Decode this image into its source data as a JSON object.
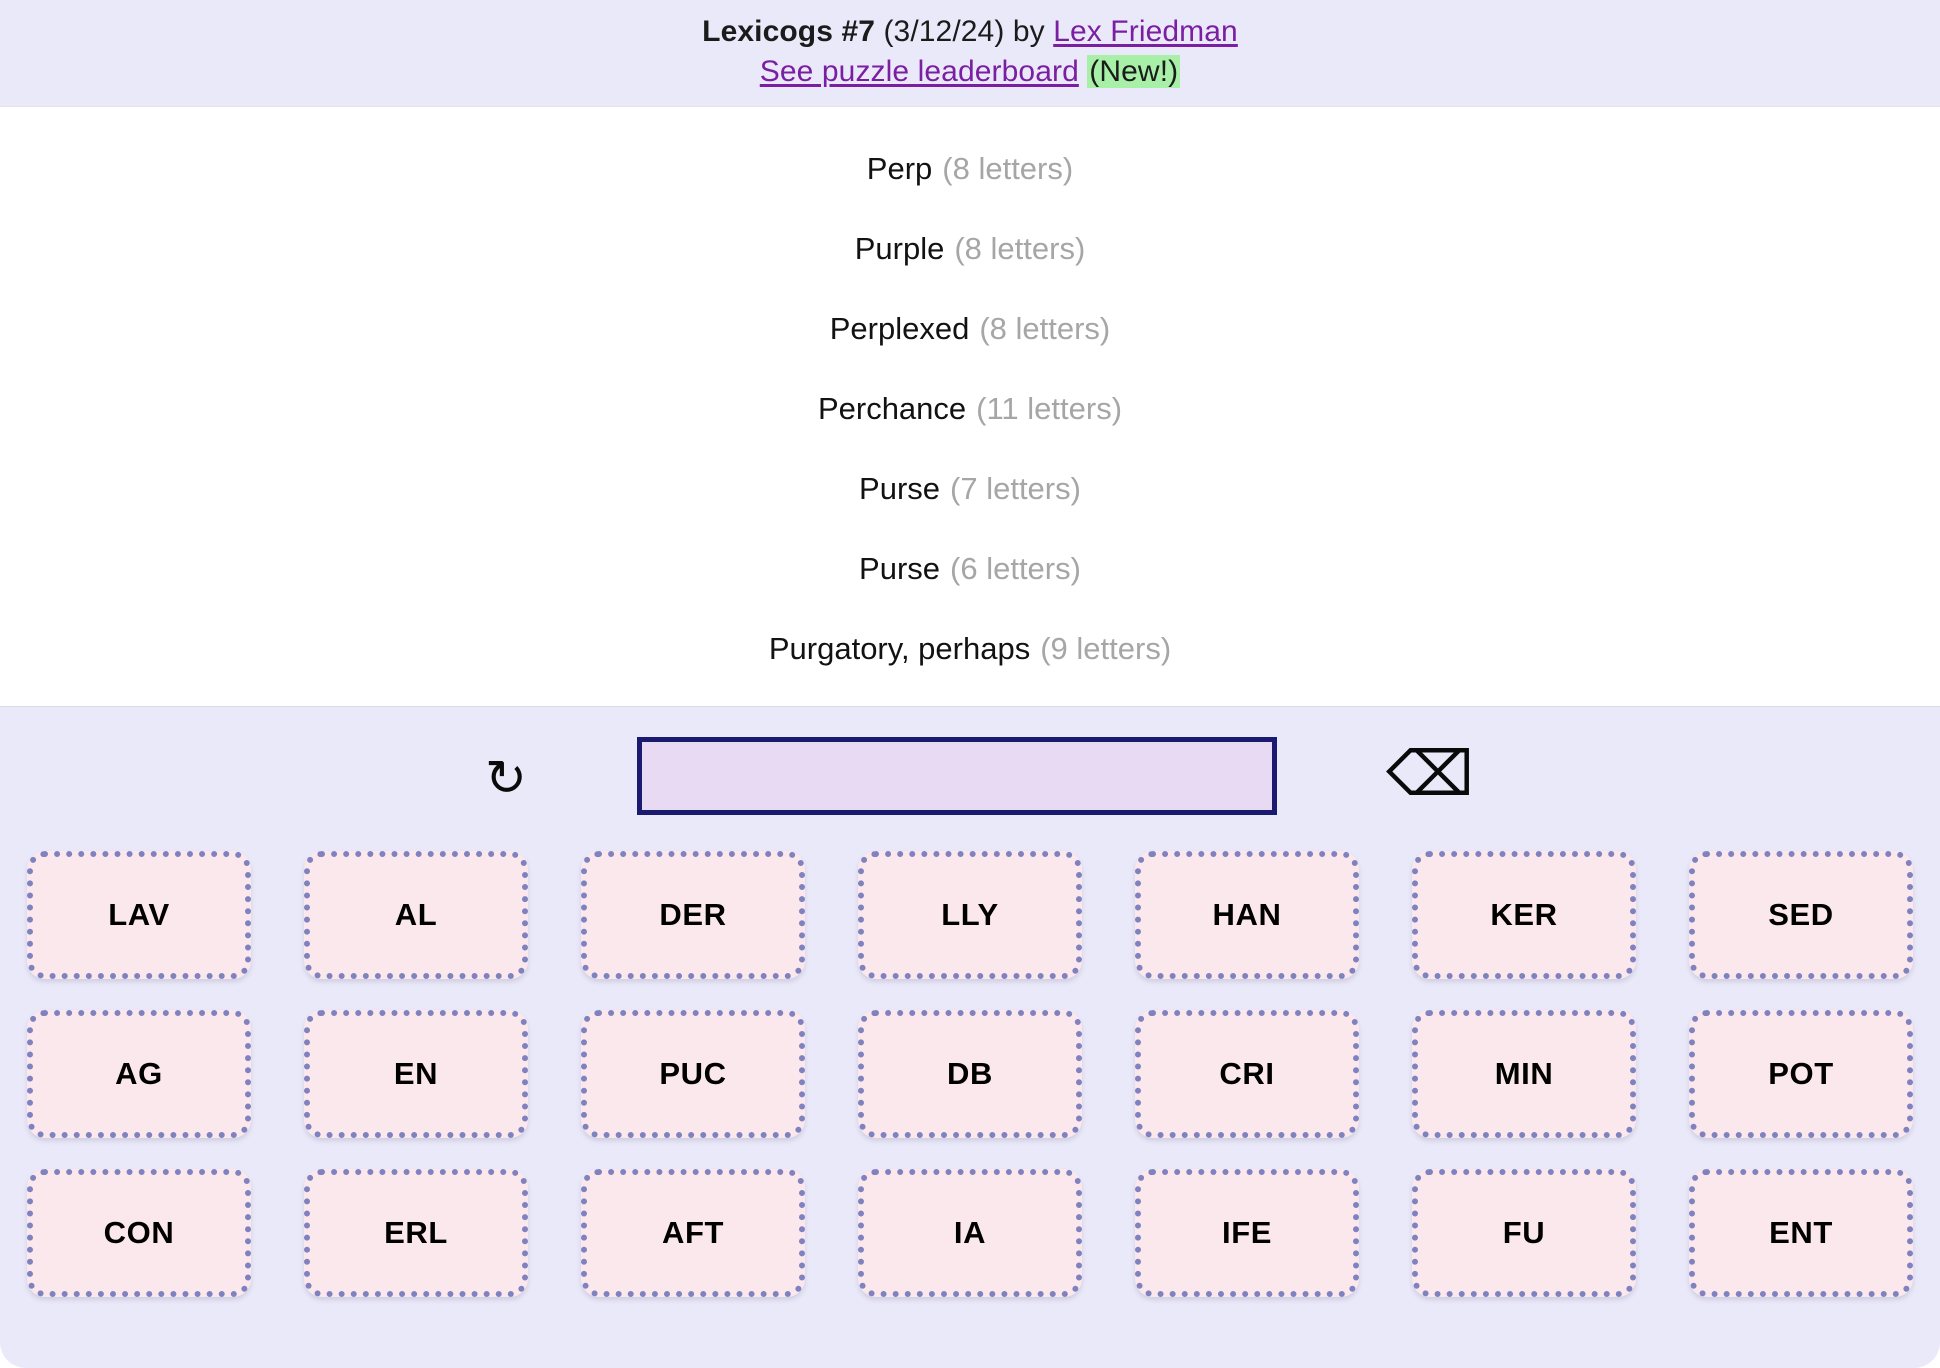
{
  "header": {
    "puzzle_name": "Lexicogs #7",
    "date": "(3/12/24)",
    "by": "by",
    "author": "Lex Friedman",
    "leaderboard_link": "See puzzle leaderboard",
    "new_badge": "(New!)"
  },
  "clues": [
    {
      "text": "Perp",
      "count": "(8 letters)"
    },
    {
      "text": "Purple",
      "count": "(8 letters)"
    },
    {
      "text": "Perplexed",
      "count": "(8 letters)"
    },
    {
      "text": "Perchance",
      "count": "(11 letters)"
    },
    {
      "text": "Purse",
      "count": "(7 letters)"
    },
    {
      "text": "Purse",
      "count": "(6 letters)"
    },
    {
      "text": "Purgatory, perhaps",
      "count": "(9 letters)"
    }
  ],
  "entry": {
    "value": "",
    "placeholder": "",
    "shuffle_icon": "↻",
    "backspace_icon": "⌫"
  },
  "tiles": [
    "LAV",
    "AL",
    "DER",
    "LLY",
    "HAN",
    "KER",
    "SED",
    "AG",
    "EN",
    "PUC",
    "DB",
    "CRI",
    "MIN",
    "POT",
    "CON",
    "ERL",
    "AFT",
    "IA",
    "IFE",
    "FU",
    "ENT"
  ],
  "colors": {
    "header_bg": "#eae9f9",
    "panel_bg": "#eae9f9",
    "card_bg": "#ffffff",
    "link": "#7b1fa2",
    "badge_bg": "#a8f0a8",
    "tile_bg": "#fbe8ec",
    "tile_border": "#8082c0",
    "entry_border": "#1a1a70",
    "entry_bg": "#e8daf3",
    "clue_count": "#a6a6a6"
  }
}
